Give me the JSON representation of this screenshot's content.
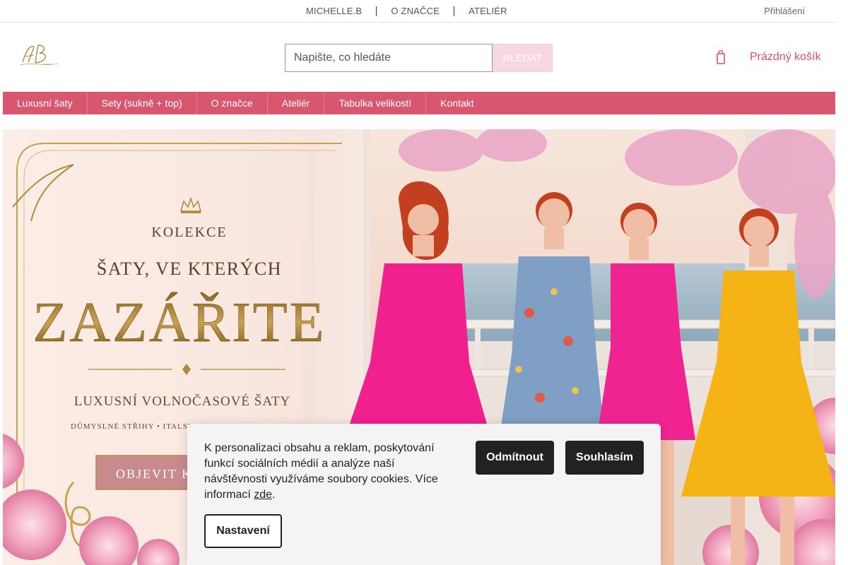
{
  "topbar": {
    "links": [
      "MICHELLE.B",
      "O ZNAČCE",
      "ATELIÉR"
    ],
    "misc_glyph": "",
    "login": "Přihlášení"
  },
  "header": {
    "logo_icon": "michelle-b-monogram-logo",
    "search": {
      "placeholder": "Napište, co hledáte",
      "button": "HLEDAT"
    },
    "cart": {
      "icon": "shopping-bag-icon",
      "label": "Prázdný košík"
    }
  },
  "mainnav": {
    "items": [
      "Luxusní šaty",
      "Sety (sukně + top)",
      "O značce",
      "Ateliér",
      "Tabulka velikostí",
      "Kontakt"
    ]
  },
  "hero": {
    "kicker": "KOLEKCE",
    "line1": "ŠATY, VE KTERÝCH",
    "headline": "ZAZÁŘITE",
    "subline": "LUXUSNÍ VOLNOČASOVÉ ŠATY",
    "tagline": "DŮMYSLNÉ STŘIHY  •  ITALSK",
    "cta": "OBJEVIT K"
  },
  "cookie": {
    "text": "K personalizaci obsahu a reklam, poskytování funkcí sociálních médií a analýze naší návštěvnosti využíváme soubory cookies. Více informací ",
    "link": "zde",
    "text_end": ".",
    "reject": "Odmítnout",
    "accept": "Souhlasím",
    "settings": "Nastavení"
  },
  "colors": {
    "accent": "#d9566f",
    "cart_text": "#d9506b",
    "search_button": "#f6d9e0",
    "dark_button": "#222222",
    "gold": "#b08a3e"
  }
}
